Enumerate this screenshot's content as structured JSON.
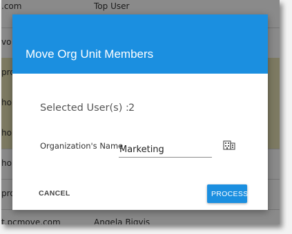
{
  "background": {
    "rows": [
      {
        "col1": ".com",
        "col2": "Top User"
      },
      {
        "col1": "vo",
        "col2": ""
      },
      {
        "col1": "pro",
        "col2": ""
      },
      {
        "col1": "ho",
        "col2": ""
      },
      {
        "col1": "ho.",
        "col2": ""
      },
      {
        "col1": "ho",
        "col2": ""
      },
      {
        "col1": "pro",
        "col2": ""
      },
      {
        "col1": "t.pcmove.com",
        "col2": "Angela Bigvis"
      }
    ]
  },
  "dialog": {
    "title": "Move Org Unit Members",
    "selected_users_label": "Selected User(s) :",
    "selected_users_count": "2",
    "org_name_label": "Organization's Name",
    "org_name_value": "Marketing",
    "org_picker_icon": "building-icon",
    "cancel_label": "CANCEL",
    "process_label": "PROCESS"
  },
  "colors": {
    "accent": "#1b8fe0",
    "highlight_row": "#e7e2b6"
  }
}
